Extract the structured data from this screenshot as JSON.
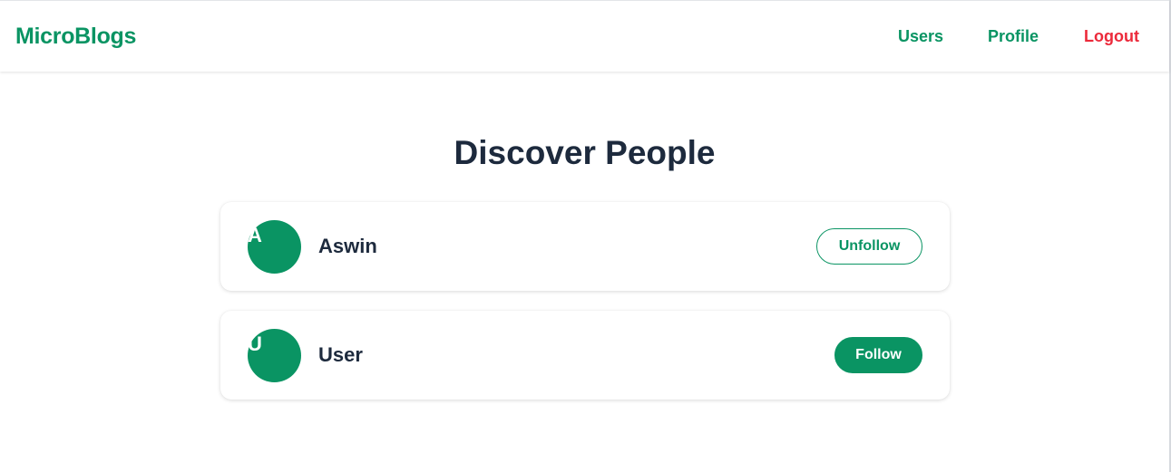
{
  "app": {
    "brand": "MicroBlogs"
  },
  "nav": {
    "users": "Users",
    "profile": "Profile",
    "logout": "Logout"
  },
  "main": {
    "title": "Discover People",
    "users": [
      {
        "initial": "A",
        "name": "Aswin",
        "action_label": "Unfollow",
        "following": true
      },
      {
        "initial": "U",
        "name": "User",
        "action_label": "Follow",
        "following": false
      }
    ]
  },
  "colors": {
    "brand": "#0a9463",
    "logout": "#ec2a3b",
    "heading": "#1d2a3d"
  },
  "icons": {
    "avatar": "avatar-circle"
  }
}
